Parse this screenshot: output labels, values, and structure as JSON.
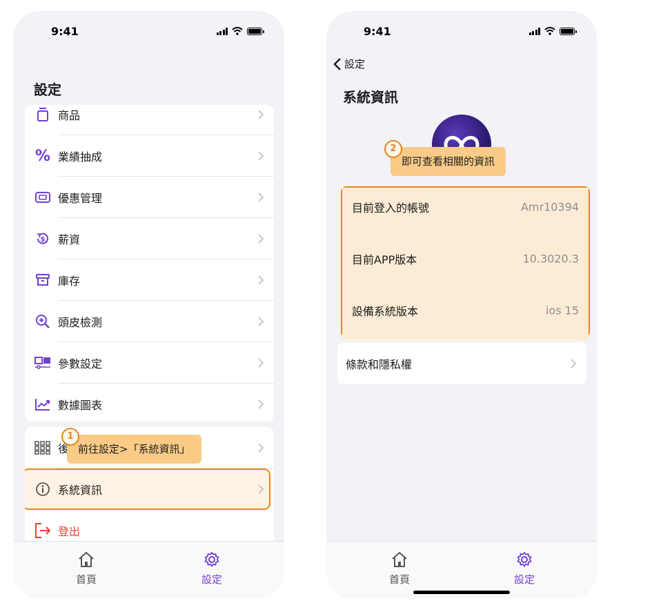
{
  "status_bar": {
    "time": "9:41"
  },
  "screen1": {
    "title": "設定",
    "menu_items": [
      {
        "label": "商品",
        "icon": "product-icon"
      },
      {
        "label": "業績抽成",
        "icon": "percent-icon"
      },
      {
        "label": "優惠管理",
        "icon": "ticket-icon"
      },
      {
        "label": "薪資",
        "icon": "salary-icon"
      },
      {
        "label": "庫存",
        "icon": "archive-icon"
      },
      {
        "label": "頭皮檢測",
        "icon": "zoom-in-icon"
      },
      {
        "label": "參數設定",
        "icon": "toggle-icon"
      },
      {
        "label": "數據圖表",
        "icon": "chart-icon"
      }
    ],
    "more_item": {
      "label": "後",
      "icon": "grid-icon"
    },
    "system_info": {
      "label": "系統資訊",
      "icon": "info-icon"
    },
    "logout": {
      "label": "登出",
      "icon": "logout-icon",
      "color": "#e5442e"
    },
    "tooltip": {
      "step": "1",
      "text": "前往設定>「系統資訊」"
    }
  },
  "screen2": {
    "back_label": "設定",
    "title": "系統資訊",
    "info_rows": [
      {
        "label": "目前登入的帳號",
        "value": "Amr10394"
      },
      {
        "label": "目前APP版本",
        "value": "10.3020.3"
      },
      {
        "label": "設備系統版本",
        "value": "ios 15"
      }
    ],
    "terms": {
      "label": "條款和隱私權"
    },
    "tooltip": {
      "step": "2",
      "text": "即可查看相關的資訊"
    }
  },
  "tabs": [
    {
      "label": "首頁",
      "icon": "home-icon"
    },
    {
      "label": "設定",
      "icon": "gear-icon"
    }
  ],
  "colors": {
    "accent": "#6f3fd1",
    "highlight_border": "#e38622",
    "tooltip_bg": "#f9cb87",
    "logout": "#e5442e"
  }
}
